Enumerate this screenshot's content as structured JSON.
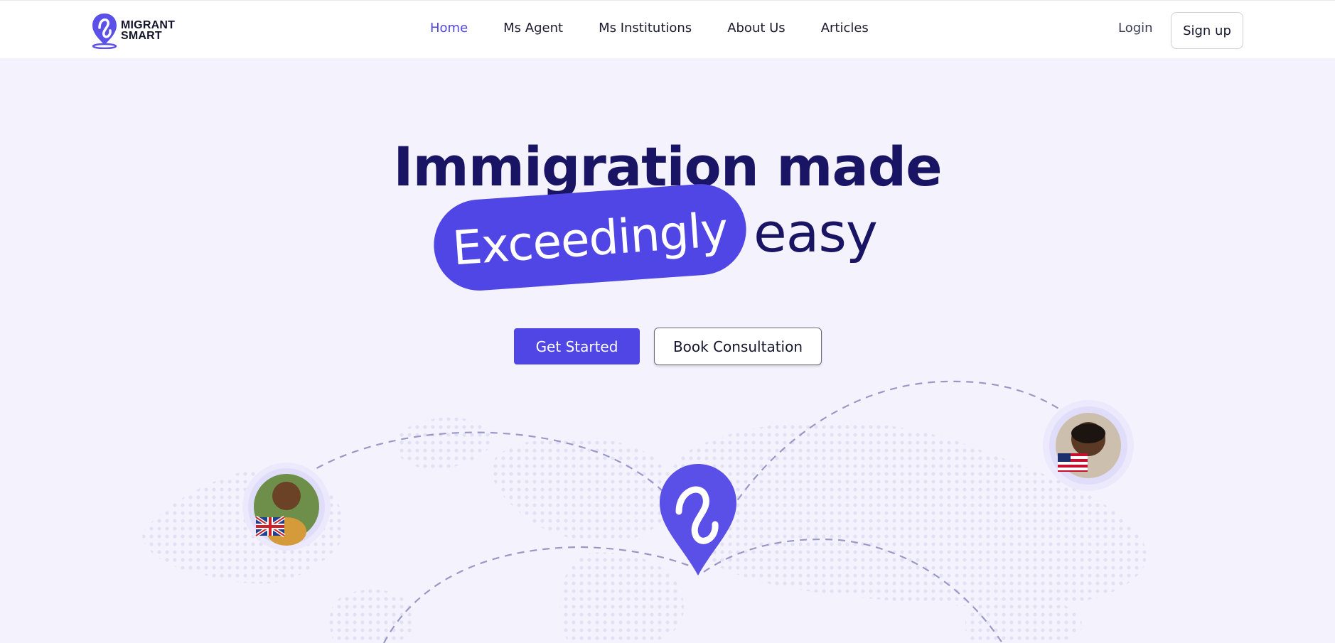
{
  "brand": {
    "line1": "MIGRANT",
    "line2": "SMART",
    "accent_color": "#5046e5",
    "dark_color": "#1a1465"
  },
  "nav": {
    "links": [
      {
        "label": "Home",
        "active": true
      },
      {
        "label": "Ms Agent",
        "active": false
      },
      {
        "label": "Ms Institutions",
        "active": false
      },
      {
        "label": "About Us",
        "active": false
      },
      {
        "label": "Articles",
        "active": false
      }
    ],
    "login_label": "Login",
    "signup_label": "Sign up"
  },
  "hero": {
    "headline_line1": "Immigration made",
    "highlight_word": "Exceedingly",
    "trailing_word": "easy",
    "primary_cta": "Get Started",
    "secondary_cta": "Book Consultation"
  },
  "illustration": {
    "icons": [
      "location-pin-logo-icon",
      "world-dot-map",
      "uk-flag-icon",
      "us-flag-icon"
    ]
  }
}
